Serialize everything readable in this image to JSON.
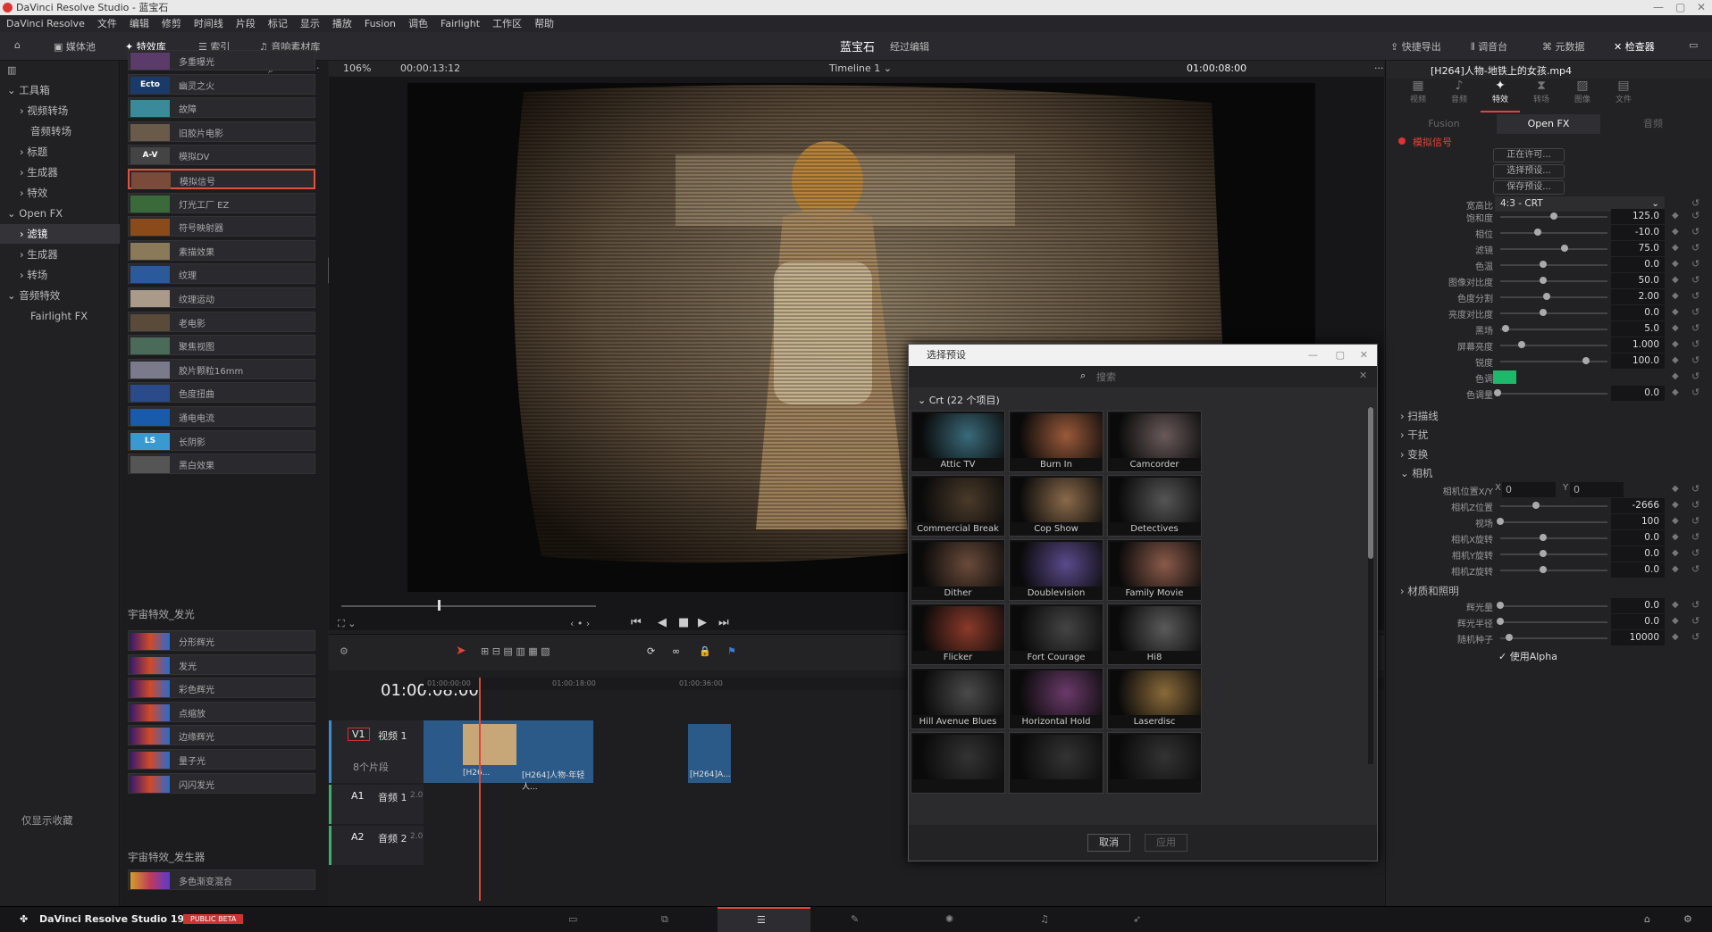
{
  "window": {
    "title": "DaVinci Resolve Studio - 蓝宝石"
  },
  "menu": [
    "DaVinci Resolve",
    "文件",
    "编辑",
    "修剪",
    "时间线",
    "片段",
    "标记",
    "显示",
    "播放",
    "Fusion",
    "调色",
    "Fairlight",
    "工作区",
    "帮助"
  ],
  "toolbar": {
    "media_pool": "媒体池",
    "effects": "特效库",
    "index": "索引",
    "sound_library": "音响素材库",
    "project_name": "蓝宝石",
    "edited": "经过编辑",
    "quick_export": "快捷导出",
    "mixer": "调音台",
    "metadata": "元数据",
    "inspector": "检查器"
  },
  "viewer": {
    "zoom": "106%",
    "source_tc": "00:00:13:12",
    "timeline_name": "Timeline 1",
    "record_tc": "01:00:08:00",
    "clip_name": "[H264]人物-地铁上的女孩.mp4"
  },
  "left_tree": [
    "工具箱",
    "视频转场",
    "音频转场",
    "标题",
    "生成器",
    "特效",
    "Open FX",
    "滤镜",
    "生成器",
    "转场",
    "音频特效",
    "Fairlight FX"
  ],
  "favorites_only": "仅显示收藏",
  "effects_list": [
    "多重曝光",
    "幽灵之火",
    "故障",
    "旧胶片电影",
    "模拟DV",
    "模拟信号",
    "灯光工厂 EZ",
    "符号映射器",
    "素描效果",
    "纹理",
    "纹理运动",
    "老电影",
    "聚焦视图",
    "胶片颗粒16mm",
    "色度扭曲",
    "通电电流",
    "长阴影",
    "黑白效果"
  ],
  "effects_thumbs": [
    "",
    "Ecto",
    "",
    "",
    "A-V",
    "",
    "",
    "",
    "",
    "",
    "",
    "",
    "",
    "",
    "",
    "",
    "LS",
    ""
  ],
  "section_glow": "宇宙特效_发光",
  "glow_list": [
    "分形辉光",
    "发光",
    "彩色辉光",
    "点缩放",
    "边缘辉光",
    "量子光",
    "闪闪发光"
  ],
  "section_gen": "宇宙特效_发生器",
  "gen_list": [
    "多色渐变混合"
  ],
  "timeline": {
    "timecode": "01:00:08:00",
    "v1": "V1",
    "v1_name": "视频 1",
    "v1_clips": "8个片段",
    "a1": "A1",
    "a1_name": "音频 1",
    "a2": "A2",
    "a2_name": "音频 2",
    "a_level": "2.0",
    "ruler": [
      "01:00:00:00",
      "01:00:18:00",
      "01:00:36:00"
    ],
    "clip1": "[H26...",
    "clip2": "[H264]人物-年轻人...",
    "clip3": "[H264]A..."
  },
  "inspector": {
    "tabs": [
      "视频",
      "音频",
      "特效",
      "转场",
      "图像",
      "文件"
    ],
    "subtabs": [
      "Fusion",
      "Open FX",
      "音频"
    ],
    "effect_name": "模拟信号",
    "buttons": [
      "正在许可...",
      "选择预设...",
      "保存预设..."
    ],
    "aspect_label": "宽高比",
    "aspect_value": "4:3 - CRT",
    "params": [
      {
        "label": "饱和度",
        "value": "125.0",
        "pos": 0.5
      },
      {
        "label": "相位",
        "value": "-10.0",
        "pos": 0.35
      },
      {
        "label": "滤镜",
        "value": "75.0",
        "pos": 0.6
      },
      {
        "label": "色温",
        "value": "0.0",
        "pos": 0.4
      },
      {
        "label": "图像对比度",
        "value": "50.0",
        "pos": 0.4
      },
      {
        "label": "色度分割",
        "value": "2.00",
        "pos": 0.43
      },
      {
        "label": "亮度对比度",
        "value": "0.0",
        "pos": 0.4
      },
      {
        "label": "黑场",
        "value": "5.0",
        "pos": 0.05
      },
      {
        "label": "屏幕亮度",
        "value": "1.000",
        "pos": 0.2
      },
      {
        "label": "锐度",
        "value": "100.0",
        "pos": 0.8
      }
    ],
    "tint_label": "色调",
    "tint_color": "#1fb86a",
    "tint_amount_label": "色调量",
    "tint_amount": "0.0",
    "groups": [
      "扫描线",
      "干扰",
      "变换",
      "相机"
    ],
    "camera_pos_label": "相机位置X/Y",
    "camera_x": "0",
    "camera_y": "0",
    "camera_params": [
      {
        "label": "相机Z位置",
        "value": "-2666",
        "pos": 0.33
      },
      {
        "label": "视场",
        "value": "100",
        "pos": 0.0
      },
      {
        "label": "相机X旋转",
        "value": "0.0",
        "pos": 0.4
      },
      {
        "label": "相机Y旋转",
        "value": "0.0",
        "pos": 0.4
      },
      {
        "label": "相机Z旋转",
        "value": "0.0",
        "pos": 0.4
      }
    ],
    "material_group": "材质和照明",
    "material_params": [
      {
        "label": "辉光量",
        "value": "0.0",
        "pos": 0.0
      },
      {
        "label": "辉光半径",
        "value": "0.0",
        "pos": 0.0
      },
      {
        "label": "随机种子",
        "value": "10000",
        "pos": 0.08
      }
    ],
    "use_alpha": "使用Alpha"
  },
  "preset_dialog": {
    "title": "选择预设",
    "search_placeholder": "搜索",
    "category": "Crt (22 个项目)",
    "presets": [
      "Attic TV",
      "Burn In",
      "Camcorder",
      "Commercial Break",
      "Cop Show",
      "Detectives",
      "Dither",
      "Doublevision",
      "Family Movie",
      "Flicker",
      "Fort Courage",
      "Hi8",
      "Hill Avenue Blues",
      "Horizontal Hold",
      "Laserdisc",
      "",
      "",
      ""
    ],
    "cancel": "取消",
    "apply": "应用"
  },
  "bottom": {
    "app": "DaVinci Resolve Studio 19",
    "badge": "PUBLIC BETA"
  }
}
